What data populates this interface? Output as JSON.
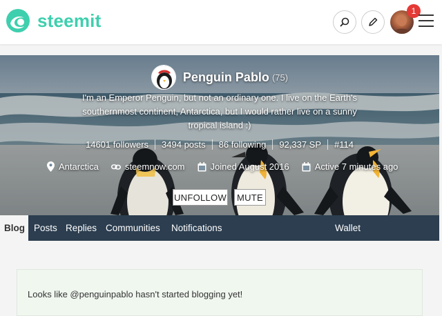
{
  "header": {
    "logo_text": "steemit",
    "brand_color": "#3ecfae",
    "notification_count": "1",
    "icons": [
      "steemit-logo-icon",
      "search-icon",
      "pencil-icon",
      "user-avatar",
      "hamburger-menu-icon"
    ]
  },
  "profile": {
    "name": "Penguin Pablo",
    "reputation": "(75)",
    "about": "I'm an Emperor Penguin, but not an ordinary one. I live on the Earth's southernmost continent, Antarctica, but I would rather live on a sunny tropical island :)",
    "stats": {
      "followers": "14601 followers",
      "posts": "3494 posts",
      "following": "86 following",
      "sp": "92,337 SP",
      "rank": "#114"
    },
    "meta": {
      "location": "Antarctica",
      "website": "steemnow.com",
      "joined": "Joined August 2016",
      "active": "Active 7 minutes ago"
    },
    "buttons": {
      "unfollow": "UNFOLLOW",
      "mute": "MUTE"
    }
  },
  "tabs": {
    "blog": "Blog",
    "posts": "Posts",
    "replies": "Replies",
    "communities": "Communities",
    "notifications": "Notifications",
    "wallet": "Wallet",
    "active": "Blog"
  },
  "content": {
    "empty_message": "Looks like @penguinpablo hasn't started blogging yet!"
  },
  "colors": {
    "tab_bar": "#2c3e50",
    "empty_card": "#f0f7ef",
    "badge": "#e53935"
  }
}
